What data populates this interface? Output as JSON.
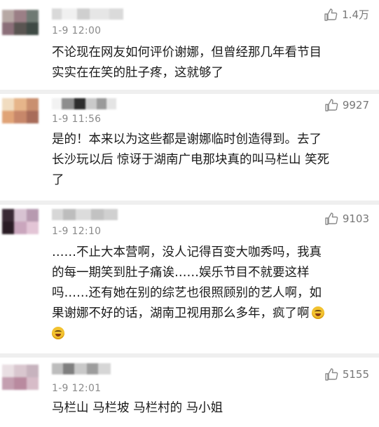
{
  "comments": [
    {
      "time": "1-9 12:00",
      "likes": "1.4万",
      "text": [
        "不论现在网友如何评价谢娜，但曾经那几年看节目",
        "实实在在笑的肚子疼，这就够了"
      ],
      "has_emoji": false
    },
    {
      "time": "1-9 11:56",
      "likes": "9927",
      "text": [
        "是的！本来以为这些都是谢娜临时创造得到。去了",
        "长沙玩以后 惊讶于湖南广电那块真的叫马栏山 笑死",
        "了"
      ],
      "has_emoji": false
    },
    {
      "time": "1-9 12:10",
      "likes": "9103",
      "text": [
        "……不止大本营啊，没人记得百变大咖秀吗，我真",
        "的每一期笑到肚子痛诶……娱乐节目不就要这样",
        "吗……还有她在别的综艺也很照顾别的艺人啊，如",
        "果谢娜不好的话，湖南卫视用那么多年，疯了啊"
      ],
      "has_emoji": true,
      "emoji_name": "laughing-tears-emoji"
    },
    {
      "time": "1-9 12:01",
      "likes": "5155",
      "text": [
        "马栏山 马栏坡 马栏村的 马小姐"
      ],
      "has_emoji": false
    }
  ],
  "icons": {
    "like": "thumbs-up-icon"
  },
  "colors": {
    "text": "#1a1a1a",
    "meta": "#8a8a8a",
    "like_count": "#777777",
    "divider": "#efefef"
  }
}
